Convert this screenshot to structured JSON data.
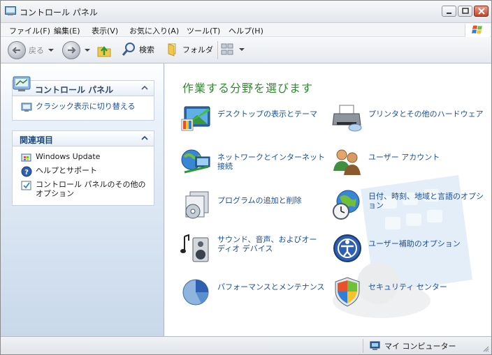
{
  "window": {
    "title": "コントロール パネル"
  },
  "menu": {
    "items": [
      "ファイル(F)",
      "編集(E)",
      "表示(V)",
      "お気に入り(A)",
      "ツール(T)",
      "ヘルプ(H)"
    ]
  },
  "toolbar": {
    "back_label": "戻る",
    "search_label": "検索",
    "folders_label": "フォルダ"
  },
  "left": {
    "cp_panel": {
      "title": "コントロール パネル",
      "classic_view_link": "クラシック表示に切り替える"
    },
    "related": {
      "title": "関連項目",
      "items": [
        "Windows Update",
        "ヘルプとサポート",
        "コントロール パネルのその他のオプション"
      ]
    }
  },
  "main": {
    "heading": "作業する分野を選びます",
    "categories": [
      {
        "label": "デスクトップの表示とテーマ",
        "icon": "desktop-theme-icon"
      },
      {
        "label": "プリンタとその他のハードウェア",
        "icon": "printer-icon"
      },
      {
        "label": "ネットワークとインターネット接続",
        "icon": "network-icon"
      },
      {
        "label": "ユーザー アカウント",
        "icon": "user-accounts-icon"
      },
      {
        "label": "プログラムの追加と削除",
        "icon": "add-remove-programs-icon"
      },
      {
        "label": "日付、時刻、地域と言語のオプション",
        "icon": "date-time-globe-icon"
      },
      {
        "label": "サウンド、音声、およびオーディオ デバイス",
        "icon": "sound-speaker-icon"
      },
      {
        "label": "ユーザー補助のオプション",
        "icon": "accessibility-icon"
      },
      {
        "label": "パフォーマンスとメンテナンス",
        "icon": "performance-chart-icon"
      },
      {
        "label": "セキュリティ センター",
        "icon": "security-shield-icon"
      }
    ]
  },
  "status": {
    "location": "マイ コンピューター"
  },
  "colors": {
    "heading_green": "#2f8a2f",
    "link_blue": "#1b4fa0"
  }
}
